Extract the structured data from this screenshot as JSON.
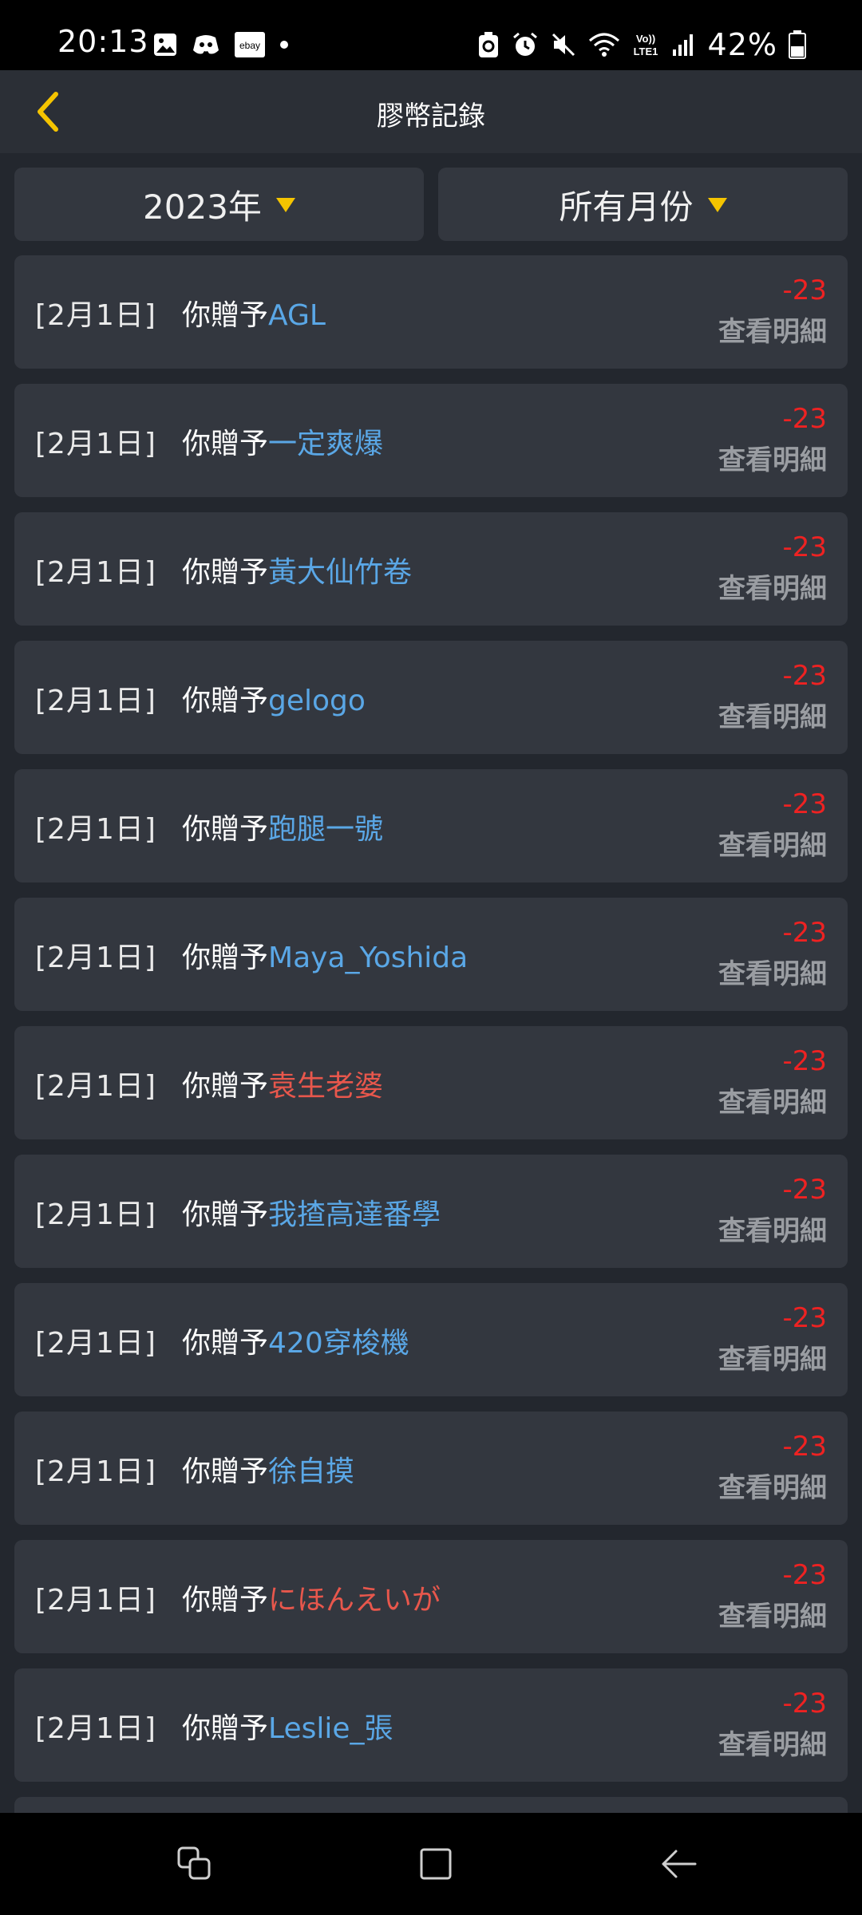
{
  "status_bar": {
    "time": "20:13",
    "battery_percent": "42%",
    "left_icons": [
      "gallery-icon",
      "discord-icon",
      "ebay-icon",
      "dot-icon"
    ],
    "right_icons": [
      "recycle-icon",
      "alarm-icon",
      "mute-icon",
      "wifi-icon",
      "volte-icon",
      "signal-icon",
      "battery-icon"
    ]
  },
  "header": {
    "title": "膠幣記錄",
    "accent_color": "#f5c400"
  },
  "filters": {
    "year": "2023年",
    "month": "所有月份"
  },
  "records": [
    {
      "date": "[2月1日]",
      "prefix": "你贈予",
      "name": "AGL",
      "name_color": "blue",
      "amount": "-23",
      "detail": "查看明細"
    },
    {
      "date": "[2月1日]",
      "prefix": "你贈予",
      "name": "一定爽爆",
      "name_color": "blue",
      "amount": "-23",
      "detail": "查看明細"
    },
    {
      "date": "[2月1日]",
      "prefix": "你贈予",
      "name": "黃大仙竹卷",
      "name_color": "blue",
      "amount": "-23",
      "detail": "查看明細"
    },
    {
      "date": "[2月1日]",
      "prefix": "你贈予",
      "name": "gelogo",
      "name_color": "blue",
      "amount": "-23",
      "detail": "查看明細"
    },
    {
      "date": "[2月1日]",
      "prefix": "你贈予",
      "name": "跑腿一號",
      "name_color": "blue",
      "amount": "-23",
      "detail": "查看明細"
    },
    {
      "date": "[2月1日]",
      "prefix": "你贈予",
      "name": "Maya_Yoshida",
      "name_color": "blue",
      "amount": "-23",
      "detail": "查看明細"
    },
    {
      "date": "[2月1日]",
      "prefix": "你贈予",
      "name": "袁生老婆",
      "name_color": "red",
      "amount": "-23",
      "detail": "查看明細"
    },
    {
      "date": "[2月1日]",
      "prefix": "你贈予",
      "name": "我揸高達番學",
      "name_color": "blue",
      "amount": "-23",
      "detail": "查看明細"
    },
    {
      "date": "[2月1日]",
      "prefix": "你贈予",
      "name": "420穿梭機",
      "name_color": "blue",
      "amount": "-23",
      "detail": "查看明細"
    },
    {
      "date": "[2月1日]",
      "prefix": "你贈予",
      "name": "徐自摸",
      "name_color": "blue",
      "amount": "-23",
      "detail": "查看明細"
    },
    {
      "date": "[2月1日]",
      "prefix": "你贈予",
      "name": "にほんえいが",
      "name_color": "red",
      "amount": "-23",
      "detail": "查看明細"
    },
    {
      "date": "[2月1日]",
      "prefix": "你贈予",
      "name": "Leslie_張",
      "name_color": "blue",
      "amount": "-23",
      "detail": "查看明細"
    }
  ],
  "nav_bar": {
    "icons": [
      "recent-apps-icon",
      "home-icon",
      "back-icon"
    ]
  }
}
